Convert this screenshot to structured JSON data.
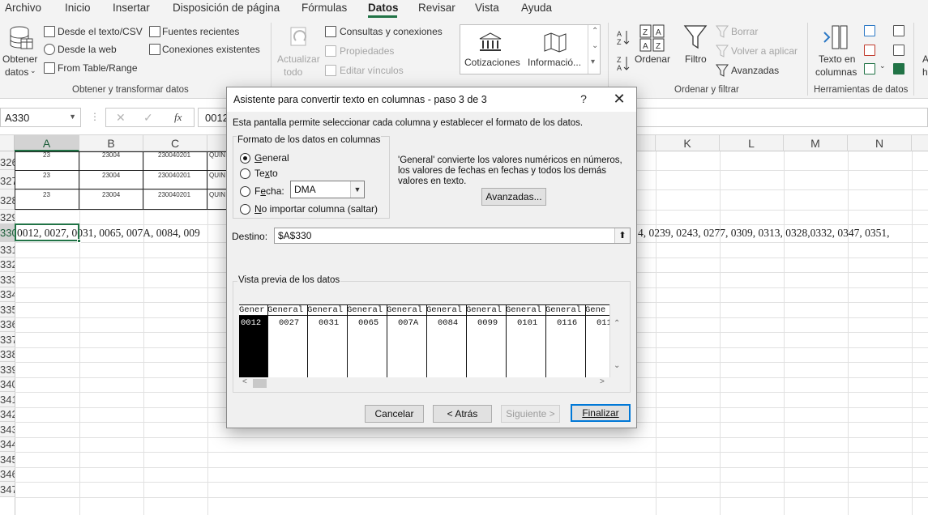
{
  "menu": {
    "tabs": [
      "Archivo",
      "Inicio",
      "Insertar",
      "Disposición de página",
      "Fórmulas",
      "Datos",
      "Revisar",
      "Vista",
      "Ayuda"
    ],
    "active_tab": "Datos"
  },
  "ribbon": {
    "get_data": {
      "label_line1": "Obtener",
      "label_line2": "datos"
    },
    "from_text_csv": "Desde el texto/CSV",
    "from_web": "Desde la web",
    "from_table_range": "From Table/Range",
    "recent_sources": "Fuentes recientes",
    "existing_connections": "Conexiones existentes",
    "group_get_transform": "Obtener y transformar datos",
    "refresh_all": {
      "line1": "Actualizar",
      "line2": "todo"
    },
    "queries_connections": "Consultas y conexiones",
    "properties": "Propiedades",
    "edit_links": "Editar vínculos",
    "data_types": [
      "Cotizaciones",
      "Informació..."
    ],
    "sort": "Ordenar",
    "filter": "Filtro",
    "clear": "Borrar",
    "reapply": "Volver a aplicar",
    "advanced": "Avanzadas",
    "group_sort_filter": "Ordenar y filtrar",
    "text_to_columns": {
      "line1": "Texto en",
      "line2": "columnas"
    },
    "group_data_tools": "Herramientas de datos",
    "cut_off_label": {
      "line1": "A",
      "line2": "h"
    }
  },
  "formula_bar": {
    "name_box": "A330",
    "formula_value": "0012"
  },
  "grid": {
    "columns": [
      "A",
      "B",
      "C",
      "K",
      "L",
      "M",
      "N"
    ],
    "rows": [
      "326",
      "327",
      "328",
      "329",
      "330",
      "331",
      "332",
      "333",
      "334",
      "335",
      "336",
      "337",
      "338",
      "339",
      "340",
      "341",
      "342",
      "343",
      "344",
      "345",
      "346",
      "347"
    ],
    "data_rows": [
      {
        "a": "23",
        "b": "23004",
        "c": "230040201",
        "d": "QUIN"
      },
      {
        "a": "23",
        "b": "23004",
        "c": "230040201",
        "d": "QUIN"
      },
      {
        "a": "23",
        "b": "23004",
        "c": "230040201",
        "d": "QUIN"
      }
    ],
    "row330_left": "0012, 0027, 0031, 0065, 007A, 0084, 009",
    "row330_right": "4, 0239, 0243, 0277, 0309, 0313, 0328,0332, 0347, 0351,"
  },
  "dialog": {
    "title": "Asistente para convertir texto en columnas - paso 3 de 3",
    "help": "?",
    "close": "✕",
    "intro": "Esta pantalla permite seleccionar cada columna y establecer el formato de los datos.",
    "format_legend": "Formato de los datos en columnas",
    "options": [
      {
        "prefix": "",
        "accel": "G",
        "rest": "eneral",
        "checked": true
      },
      {
        "prefix": "Te",
        "accel": "x",
        "rest": "to",
        "checked": false
      },
      {
        "prefix": "F",
        "accel": "e",
        "rest": "cha:",
        "checked": false
      },
      {
        "prefix": "",
        "accel": "N",
        "rest": "o importar columna (saltar)",
        "checked": false
      }
    ],
    "date_format": "DMA",
    "general_description": "'General' convierte los valores numéricos en números, los valores de fechas en fechas y todos los demás valores en texto.",
    "advanced_button": "Avanzadas...",
    "destination_label": "Destino:",
    "destination_value": "$A$330",
    "preview_legend": "Vista previa de los datos",
    "preview_headers": [
      "Gener",
      "General",
      "General",
      "General",
      "General",
      "General",
      "General",
      "General",
      "General",
      "Gene"
    ],
    "preview_values": [
      "0012",
      "0027",
      "0031",
      "0065",
      "007A",
      "0084",
      "0099",
      "0101",
      "0116",
      "011"
    ],
    "buttons": {
      "cancel": "Cancelar",
      "back": "< Atrás",
      "next": "Siguiente >",
      "finish": "Finalizar"
    }
  }
}
